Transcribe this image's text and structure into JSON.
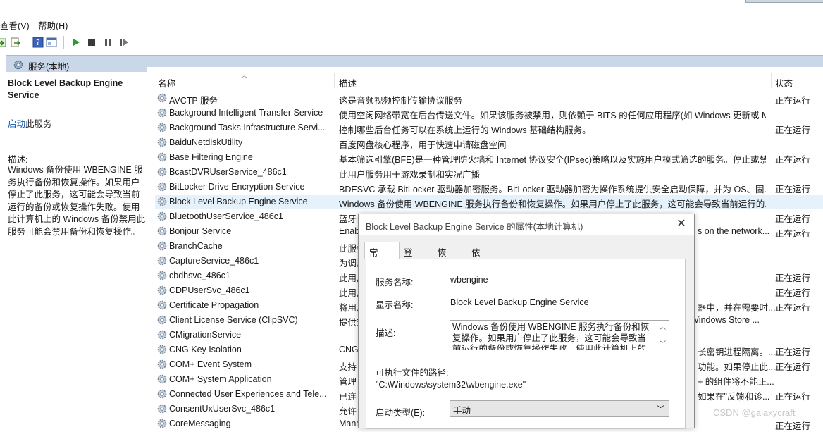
{
  "menu": {
    "view": "查看(V)",
    "help": "帮助(H)"
  },
  "toolbar": {
    "icons": [
      "back-icon",
      "export-icon",
      "help-icon",
      "console-icon",
      "play-icon",
      "stop-icon",
      "pause-icon",
      "restart-icon"
    ]
  },
  "pane_header": {
    "title": "服务(本地)"
  },
  "left_panel": {
    "service_title": "Block Level Backup Engine Service",
    "start_link": "启动",
    "start_suffix": "此服务",
    "desc_label": "描述:",
    "desc_text": "Windows 备份使用 WBENGINE 服务执行备份和恢复操作。如果用户停止了此服务，这可能会导致当前运行的备份或恢复操作失败。使用此计算机上的 Windows 备份禁用此服务可能会禁用备份和恢复操作。"
  },
  "columns": {
    "name": "名称",
    "description": "描述",
    "status": "状态"
  },
  "rows": [
    {
      "name": "AVCTP 服务",
      "desc": "这是音频视频控制传输协议服务",
      "status": "正在运行"
    },
    {
      "name": "Background Intelligent Transfer Service",
      "desc": "使用空闲网络带宽在后台传送文件。如果该服务被禁用，则依赖于 BITS 的任何应用程序(如 Windows 更新或 M...",
      "status": ""
    },
    {
      "name": "Background Tasks Infrastructure Servi...",
      "desc": "控制哪些后台任务可以在系统上运行的 Windows 基础结构服务。",
      "status": "正在运行"
    },
    {
      "name": "BaiduNetdiskUtility",
      "desc": "百度网盘核心程序，用于快速申请磁盘空间",
      "status": ""
    },
    {
      "name": "Base Filtering Engine",
      "desc": "基本筛选引擎(BFE)是一种管理防火墙和 Internet 协议安全(IPsec)策略以及实施用户模式筛选的服务。停止或禁...",
      "status": "正在运行"
    },
    {
      "name": "BcastDVRUserService_486c1",
      "desc": "此用户服务用于游戏录制和实况广播",
      "status": ""
    },
    {
      "name": "BitLocker Drive Encryption Service",
      "desc": "BDESVC 承载 BitLocker 驱动器加密服务。BitLocker 驱动器加密为操作系统提供安全启动保障，并为 OS、固...",
      "status": "正在运行"
    },
    {
      "name": "Block Level Backup Engine Service",
      "desc": "Windows 备份使用 WBENGINE 服务执行备份和恢复操作。如果用户停止了此服务，这可能会导致当前运行的...",
      "status": ""
    },
    {
      "name": "BluetoothUserService_486c1",
      "desc": "蓝牙",
      "status": "正在运行"
    },
    {
      "name": "Bonjour Service",
      "desc": "Enab",
      "status": "正在运行",
      "desc_tail": "s on the network..."
    },
    {
      "name": "BranchCache",
      "desc": "此服务",
      "status": ""
    },
    {
      "name": "CaptureService_486c1",
      "desc": "为调用",
      "status": ""
    },
    {
      "name": "cbdhsvc_486c1",
      "desc": "此用户",
      "status": "正在运行"
    },
    {
      "name": "CDPUserSvc_486c1",
      "desc": "此用户",
      "status": "正在运行"
    },
    {
      "name": "Certificate Propagation",
      "desc": "将用户",
      "status": "正在运行",
      "desc_tail": "器中，并在需要时..."
    },
    {
      "name": "Client License Service (ClipSVC)",
      "desc": "提供对",
      "status": "",
      "desc_tail": "Windows Store ..."
    },
    {
      "name": "CMigrationService",
      "desc": "",
      "status": ""
    },
    {
      "name": "CNG Key Isolation",
      "desc": "CNG",
      "status": "正在运行",
      "desc_tail": "长密钥进程隔离。..."
    },
    {
      "name": "COM+ Event System",
      "desc": "支持",
      "status": "正在运行",
      "desc_tail": "功能。如果停止此..."
    },
    {
      "name": "COM+ System Application",
      "desc": "管理",
      "status": "",
      "desc_tail": "+ 的组件将不能正..."
    },
    {
      "name": "Connected User Experiences and Tele...",
      "desc": "已连",
      "status": "正在运行",
      "desc_tail": "如果在\"反馈和诊..."
    },
    {
      "name": "ConsentUxUserSvc_486c1",
      "desc": "允许",
      "status": ""
    },
    {
      "name": "CoreMessaging",
      "desc": "Mana",
      "status": "正在运行"
    }
  ],
  "dialog": {
    "title": "Block Level Backup Engine Service 的属性(本地计算机)",
    "tabs": [
      "常规",
      "登录",
      "恢复",
      "依存关系"
    ],
    "service_name_label": "服务名称:",
    "service_name": "wbengine",
    "display_name_label": "显示名称:",
    "display_name": "Block Level Backup Engine Service",
    "desc_label": "描述:",
    "desc_text": "Windows 备份使用 WBENGINE 服务执行备份和恢复操作。如果用户停止了此服务，这可能会导致当前运行的备份或恢复操作失败。使用此计算机上的 Windows",
    "path_label": "可执行文件的路径:",
    "path": "\"C:\\Windows\\system32\\wbengine.exe\"",
    "startup_label": "启动类型(E):",
    "startup_value": "手动"
  },
  "watermark": "CSDN @galaxycraft"
}
